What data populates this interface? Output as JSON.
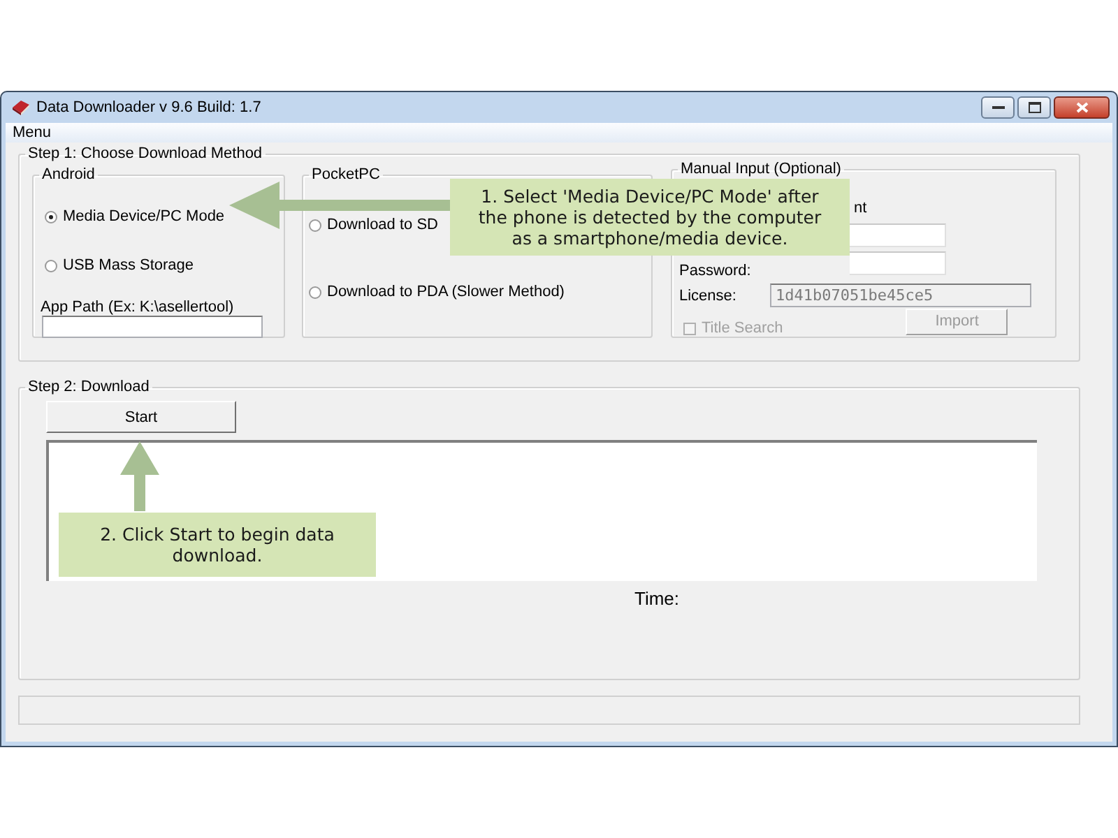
{
  "window": {
    "title": "Data Downloader v 9.6 Build: 1.7"
  },
  "menu": [
    "Menu"
  ],
  "step1": {
    "legend": "Step 1: Choose Download Method",
    "android": {
      "legend": "Android",
      "options": [
        {
          "label": "Media Device/PC Mode",
          "selected": true
        },
        {
          "label": "USB Mass Storage",
          "selected": false
        }
      ],
      "app_path_label": "App Path (Ex: K:\\asellertool)"
    },
    "pocketpc": {
      "legend": "PocketPC",
      "options": [
        {
          "label": "Download to SD",
          "selected": false
        },
        {
          "label": "Download to PDA (Slower Method)",
          "selected": false
        }
      ]
    },
    "manual_input": {
      "legend": "Manual Input (Optional)",
      "partial_label": "nt",
      "password_label": "Password:",
      "license_label": "License:",
      "license_value": "1d41b07051be45ce5",
      "title_search": {
        "label": "Title Search",
        "checked": false,
        "disabled": true
      },
      "import_button": {
        "label": "Import",
        "disabled": true
      }
    }
  },
  "step2": {
    "legend": "Step 2: Download",
    "start_button": "Start",
    "time_label": "Time:"
  },
  "callouts": [
    {
      "text": "1. Select 'Media Device/PC Mode' after the phone is detected by the computer as a smartphone/media device."
    },
    {
      "text": "2. Click Start to begin data download."
    }
  ]
}
